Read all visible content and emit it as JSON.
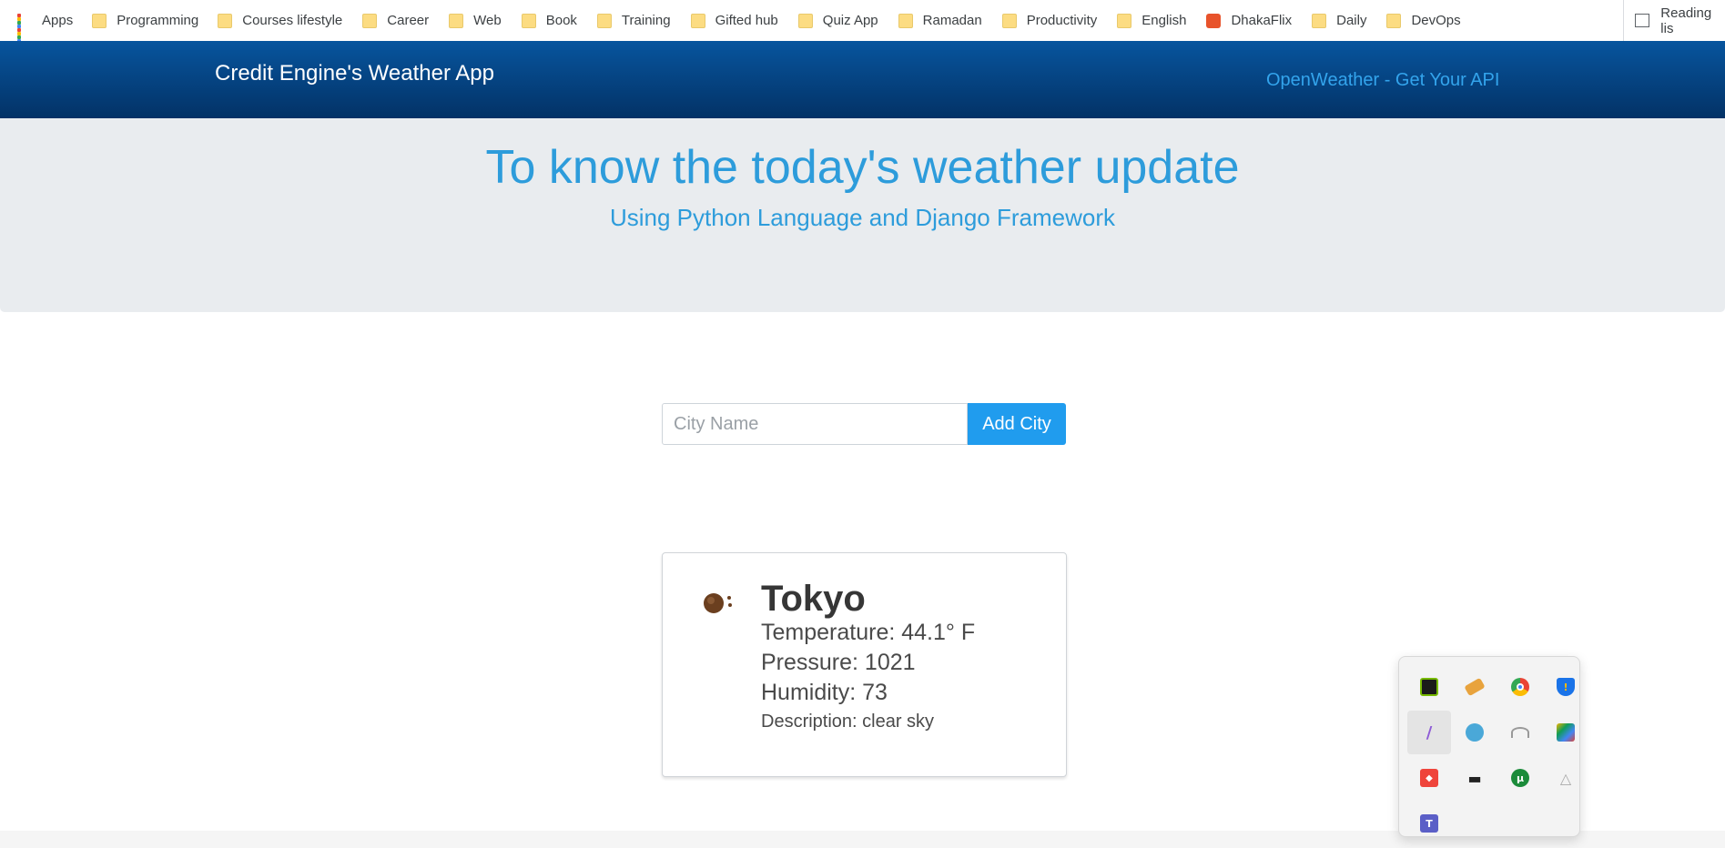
{
  "bookmarks": {
    "items": [
      {
        "label": "Apps",
        "icon": "apps-grid-icon"
      },
      {
        "label": "Programming",
        "icon": "folder-icon"
      },
      {
        "label": "Courses lifestyle",
        "icon": "folder-icon"
      },
      {
        "label": "Career",
        "icon": "folder-icon"
      },
      {
        "label": "Web",
        "icon": "folder-icon"
      },
      {
        "label": "Book",
        "icon": "folder-icon"
      },
      {
        "label": "Training",
        "icon": "folder-icon"
      },
      {
        "label": "Gifted hub",
        "icon": "folder-icon"
      },
      {
        "label": "Quiz App",
        "icon": "folder-icon"
      },
      {
        "label": "Ramadan",
        "icon": "folder-icon"
      },
      {
        "label": "Productivity",
        "icon": "folder-icon"
      },
      {
        "label": "English",
        "icon": "folder-icon"
      },
      {
        "label": "DhakaFlix",
        "icon": "dhakaflix-icon"
      },
      {
        "label": "Daily",
        "icon": "folder-icon"
      },
      {
        "label": "DevOps",
        "icon": "folder-icon"
      }
    ],
    "reading_list": "Reading lis"
  },
  "navbar": {
    "brand": "Credit Engine's Weather App",
    "link": "OpenWeather - Get Your API"
  },
  "hero": {
    "title": "To know the today's weather update",
    "subtitle": "Using Python Language and Django Framework"
  },
  "form": {
    "placeholder": "City Name",
    "value": "",
    "button": "Add City"
  },
  "weather": {
    "city": "Tokyo",
    "temperature": "Temperature: 44.1° F",
    "pressure": "Pressure: 1021",
    "humidity": "Humidity: 73",
    "description": "Description: clear sky",
    "icon": "clear-sky-icon"
  },
  "tray": {
    "icons": [
      "nvidia-icon",
      "pencil-app-icon",
      "chrome-icon",
      "defender-warning-icon",
      "feather-icon",
      "paw-cloud-icon",
      "gauge-icon",
      "image-app-icon",
      "anydesk-icon",
      "docker-icon",
      "utorrent-icon",
      "google-drive-icon",
      "teams-icon"
    ]
  },
  "colors": {
    "navbar": "#033266",
    "hero_bg": "#e9ecef",
    "hero_text": "#2d9cdb",
    "button": "#209cee",
    "link": "#33a4ec"
  }
}
